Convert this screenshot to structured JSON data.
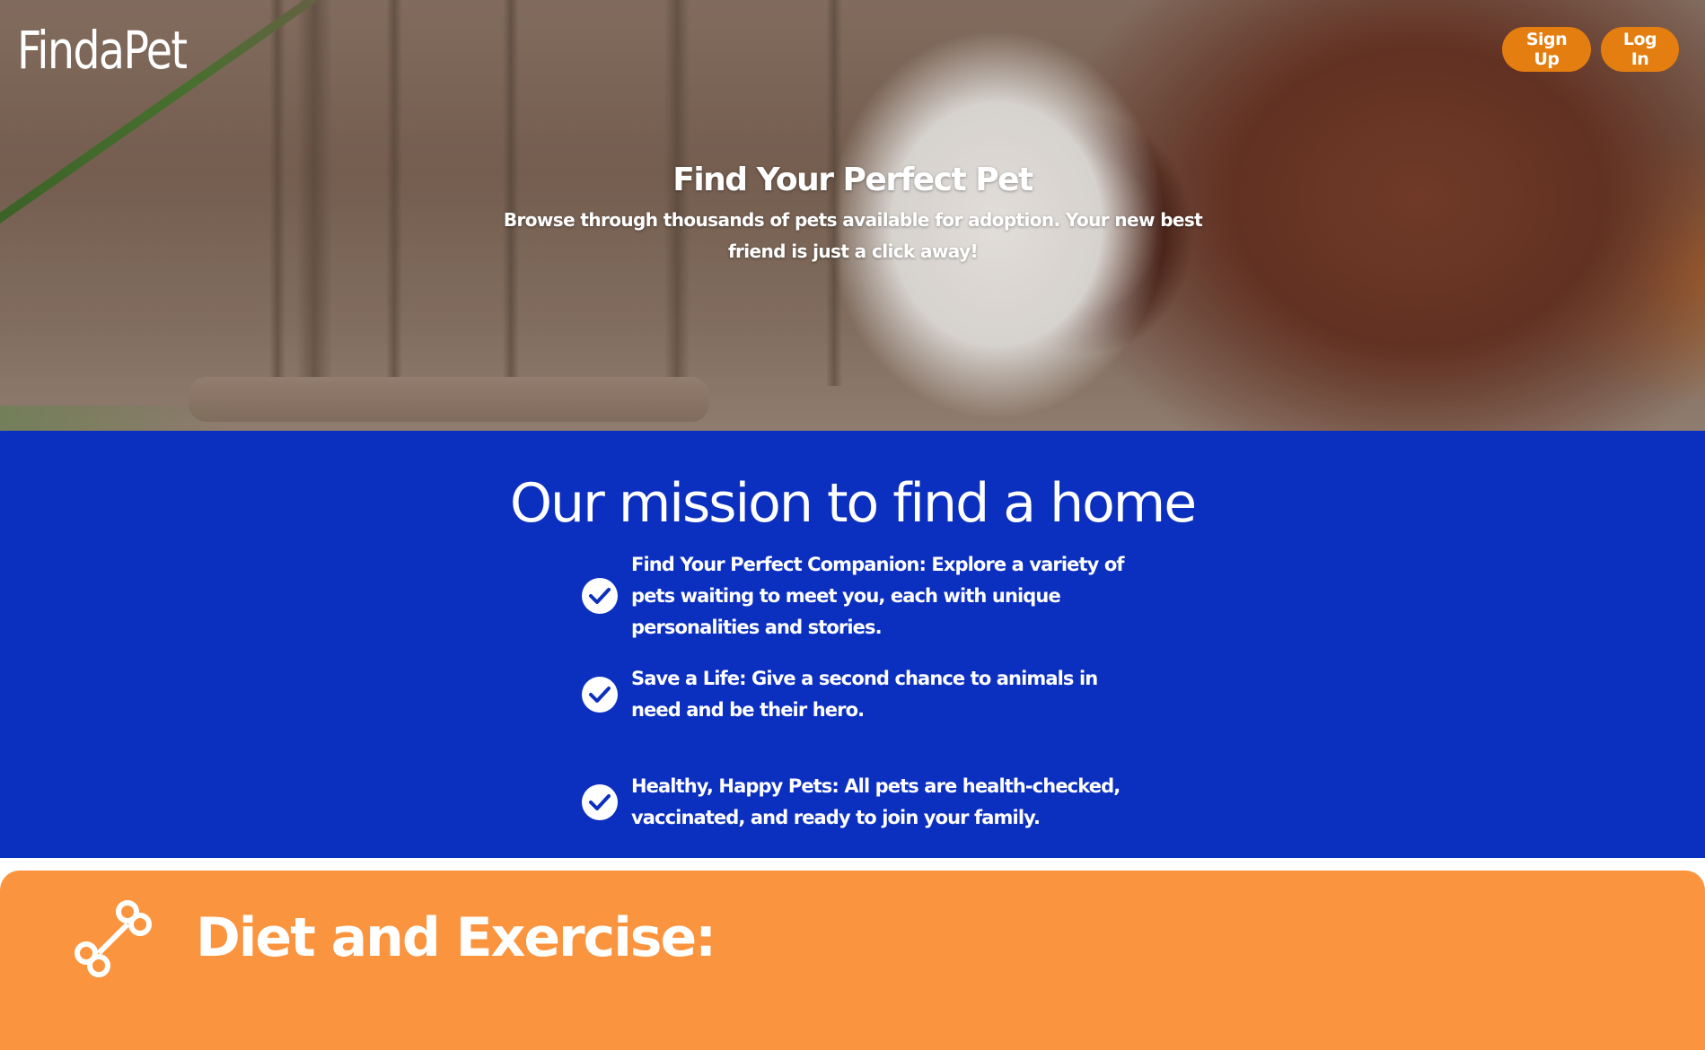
{
  "brand": {
    "name": "FindaPet"
  },
  "auth": {
    "signup_label": "Sign Up",
    "login_label": "Log In"
  },
  "hero": {
    "title": "Find Your Perfect Pet",
    "subtitle": "Browse through thousands of pets available for adoption. Your new best friend is just a click away!"
  },
  "mission": {
    "title": "Our mission to find a home",
    "items": [
      {
        "icon": "check-circle-icon",
        "text": "Find Your Perfect Companion: Explore a variety of pets waiting to meet you, each with unique personalities and stories."
      },
      {
        "icon": "check-circle-icon",
        "text": "Save a Life: Give a second chance to animals in need and be their hero."
      },
      {
        "icon": "check-circle-icon",
        "text": "Healthy, Happy Pets: All pets are health-checked, vaccinated, and ready to join your family."
      }
    ]
  },
  "diet": {
    "icon": "bone-icon",
    "title": "Diet and Exercise:"
  },
  "colors": {
    "accent_orange": "#e57e10",
    "mission_blue": "#0b2fbf",
    "card_orange": "#fb943e"
  }
}
